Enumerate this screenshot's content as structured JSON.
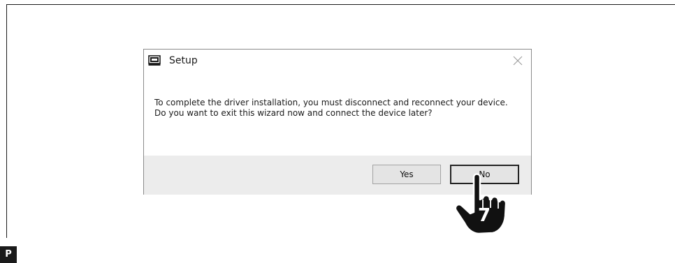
{
  "dialog": {
    "title": "Setup",
    "app_icon": "setup-app-icon",
    "close_icon": "close-icon",
    "message": "To complete the driver installation, you must disconnect and reconnect your device. Do you want to exit this wizard now and connect the device later?",
    "buttons": {
      "yes_label": "Yes",
      "no_label": "No"
    }
  },
  "callout": {
    "icon": "pointing-hand-icon",
    "step_number": "7"
  },
  "corner_badge": {
    "label": "P"
  },
  "colors": {
    "dialog_background": "#ffffff",
    "button_bar": "#ececec",
    "button_face": "#e4e4e4",
    "hand_fill": "#111111",
    "badge_fill": "#1a1a1a"
  }
}
